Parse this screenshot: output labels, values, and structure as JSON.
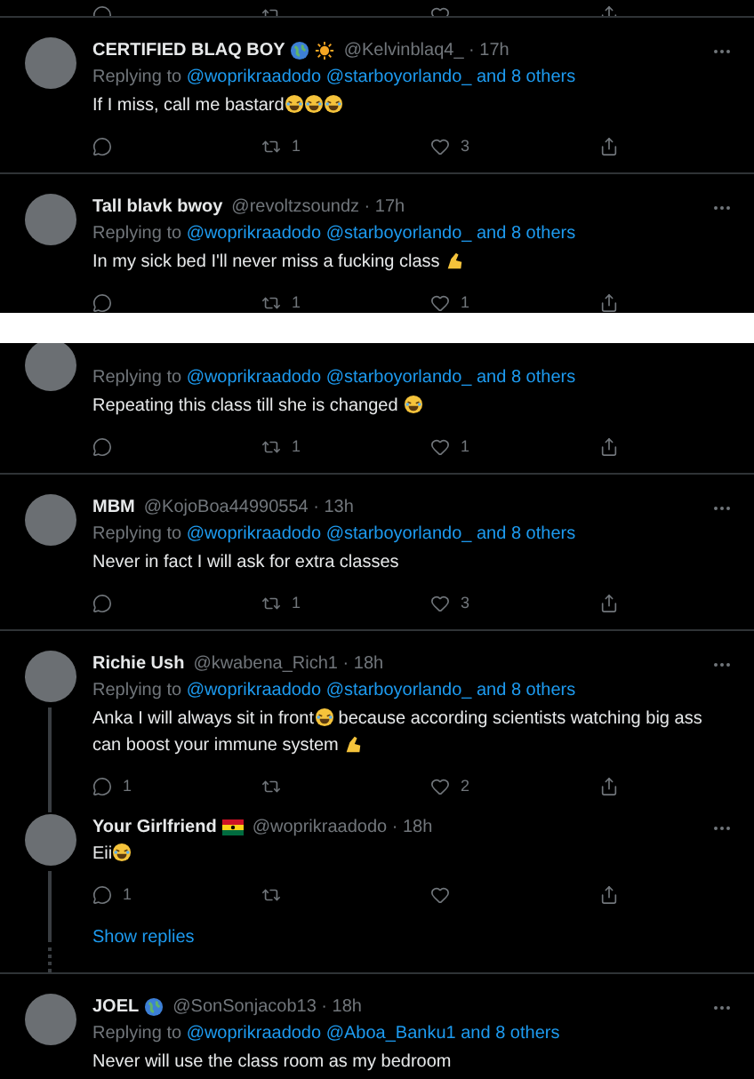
{
  "panels": [
    {
      "tweets": [
        {
          "kind": "actions_only",
          "actions": [
            {
              "kind": "reply"
            },
            {
              "kind": "retweet"
            },
            {
              "kind": "like"
            },
            {
              "kind": "share"
            }
          ]
        },
        {
          "kind": "tweet",
          "name": "CERTIFIED BLAQ BOY",
          "badges": [
            {
              "kind": "globe"
            },
            {
              "kind": "sun"
            }
          ],
          "meta": "@Kelvinblaq4_ · 17h",
          "replying_to": {
            "prefix": "Replying to",
            "mentions": [
              "@woprikraadodo",
              "@starboyorlando_",
              "and 8 others"
            ]
          },
          "body": [
            {
              "kind": "text",
              "text": "If I miss, call me bastard"
            },
            {
              "kind": "laughing_emoji"
            },
            {
              "kind": "laughing_emoji"
            },
            {
              "kind": "laughing_emoji"
            }
          ],
          "actions": [
            {
              "kind": "reply"
            },
            {
              "kind": "retweet",
              "count": "1"
            },
            {
              "kind": "like",
              "count": "3"
            },
            {
              "kind": "share"
            }
          ]
        },
        {
          "kind": "tweet",
          "name": "Tall blavk bwoy",
          "meta": "@revoltzsoundz · 17h",
          "replying_to": {
            "prefix": "Replying to",
            "mentions": [
              "@woprikraadodo",
              "@starboyorlando_",
              "and 8 others"
            ]
          },
          "body": [
            {
              "kind": "text",
              "text": "In my sick bed I'll never miss a fucking class "
            },
            {
              "kind": "hand_emoji"
            }
          ],
          "actions": [
            {
              "kind": "reply"
            },
            {
              "kind": "retweet",
              "count": "1"
            },
            {
              "kind": "like",
              "count": "1"
            },
            {
              "kind": "share"
            }
          ]
        }
      ]
    },
    {
      "tweets": [
        {
          "kind": "tweet",
          "header_cut": true,
          "replying_to": {
            "prefix": "Replying to",
            "mentions": [
              "@woprikraadodo",
              "@starboyorlando_",
              "and 8 others"
            ]
          },
          "body": [
            {
              "kind": "text",
              "text": "Repeating this class till she is changed "
            },
            {
              "kind": "laughing_emoji"
            }
          ],
          "actions": [
            {
              "kind": "reply"
            },
            {
              "kind": "retweet",
              "count": "1"
            },
            {
              "kind": "like",
              "count": "1"
            },
            {
              "kind": "share"
            }
          ]
        },
        {
          "kind": "tweet",
          "name": "MBM",
          "meta": "@KojoBoa44990554 · 13h",
          "replying_to": {
            "prefix": "Replying to",
            "mentions": [
              "@woprikraadodo",
              "@starboyorlando_",
              "and 8 others"
            ]
          },
          "body": [
            {
              "kind": "text",
              "text": "Never in fact I will ask for extra classes"
            }
          ],
          "actions": [
            {
              "kind": "reply"
            },
            {
              "kind": "retweet",
              "count": "1"
            },
            {
              "kind": "like",
              "count": "3"
            },
            {
              "kind": "share"
            }
          ]
        },
        {
          "kind": "tweet",
          "name": "Richie Ush",
          "meta": "@kwabena_Rich1 · 18h",
          "thread_continues": true,
          "replying_to": {
            "prefix": "Replying to",
            "mentions": [
              "@woprikraadodo",
              "@starboyorlando_",
              "and 8 others"
            ]
          },
          "body": [
            {
              "kind": "text",
              "text": "Anka I will always sit in front"
            },
            {
              "kind": "laughing_emoji"
            },
            {
              "kind": "text",
              "text": " because according scientists watching big ass can boost your immune system "
            },
            {
              "kind": "hand_emoji"
            }
          ],
          "actions": [
            {
              "kind": "reply",
              "count": "1"
            },
            {
              "kind": "retweet"
            },
            {
              "kind": "like",
              "count": "2"
            },
            {
              "kind": "share"
            }
          ]
        },
        {
          "kind": "tweet",
          "name": "Your Girlfriend",
          "badges": [
            {
              "kind": "flag"
            }
          ],
          "meta": "@woprikraadodo · 18h",
          "thread_child": true,
          "body": [
            {
              "kind": "text",
              "text": "Eii"
            },
            {
              "kind": "laughing_emoji"
            }
          ],
          "actions": [
            {
              "kind": "reply",
              "count": "1"
            },
            {
              "kind": "retweet"
            },
            {
              "kind": "like"
            },
            {
              "kind": "share"
            }
          ],
          "show_replies": "Show replies"
        },
        {
          "kind": "tweet",
          "name": "JOEL",
          "badges": [
            {
              "kind": "globe"
            }
          ],
          "meta": "@SonSonjacob13 · 18h",
          "replying_to": {
            "prefix": "Replying to",
            "mentions": [
              "@woprikraadodo",
              "@Aboa_Banku1",
              "and 8 others"
            ]
          },
          "body": [
            {
              "kind": "text",
              "text": "Never will use the class room as my bedroom"
            }
          ]
        }
      ]
    }
  ]
}
